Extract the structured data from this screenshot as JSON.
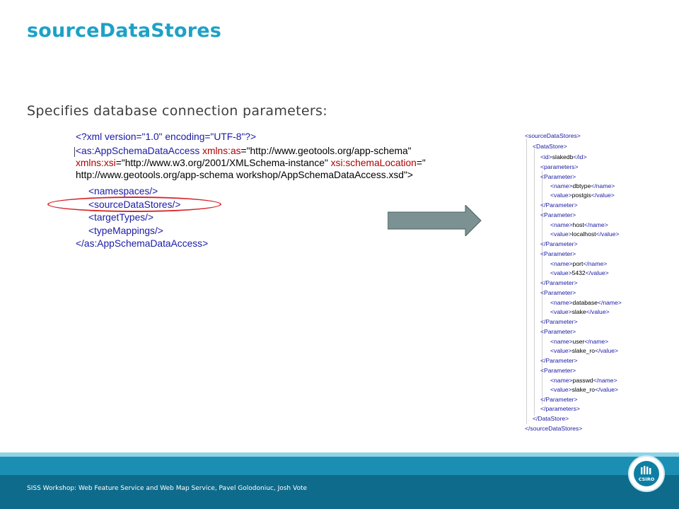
{
  "slide": {
    "title": "sourceDataStores",
    "subtitle": "Specifies database connection parameters:"
  },
  "xml_snippet": {
    "line1": "<?xml version=\"1.0\" encoding=\"UTF-8\"?>",
    "line2_tag": "<as:AppSchemaDataAccess",
    "line2_attr": "xmlns:as",
    "line2_val": "\"http://www.geotools.org/app-schema\"",
    "line3_attr1": "xmlns:xsi",
    "line3_val1": "\"http://www.w3.org/2001/XMLSchema-instance\"",
    "line3_attr2": "xsi:schemaLocation",
    "line3_eq": "=\"",
    "line4": "http://www.geotools.org/app-schema workshop/AppSchemaDataAccess.xsd\">",
    "namespaces": "<namespaces/>",
    "sourceDataStores": "<sourceDataStores/>",
    "targetTypes": "<targetTypes/>",
    "typeMappings": "<typeMappings/>",
    "close": "</as:AppSchemaDataAccess>"
  },
  "xml_detail": {
    "root_open": "<sourceDataStores>",
    "datastore_open": "<DataStore>",
    "id_open": "<id>",
    "id_value": "slakedb",
    "id_close": "</id>",
    "parameters_open": "<parameters>",
    "parameter_open": "<Parameter>",
    "parameter_close": "</Parameter>",
    "name_open": "<name>",
    "name_close": "</name>",
    "value_open": "<value>",
    "value_close": "</value>",
    "params": [
      {
        "name": "dbtype",
        "value": "postgis"
      },
      {
        "name": "host",
        "value": "localhost"
      },
      {
        "name": "port",
        "value": "5432"
      },
      {
        "name": "database",
        "value": "slake"
      },
      {
        "name": "user",
        "value": "slake_ro"
      },
      {
        "name": "passwd",
        "value": "slake_ro"
      }
    ],
    "parameters_close": "</parameters>",
    "datastore_close": "</DataStore>",
    "root_close": "</sourceDataStores>"
  },
  "footer": {
    "text": "SISS Workshop: Web Feature Service and Web Map Service, Pavel Golodoniuc, Josh Vote",
    "logo_text": "CSIRO"
  },
  "colors": {
    "title": "#1ea1c6",
    "tag": "#1a1aa5",
    "attribute": "#b00000",
    "highlight": "#d7262a",
    "arrow": "#7c9191",
    "footer": "#0f6b8b"
  }
}
